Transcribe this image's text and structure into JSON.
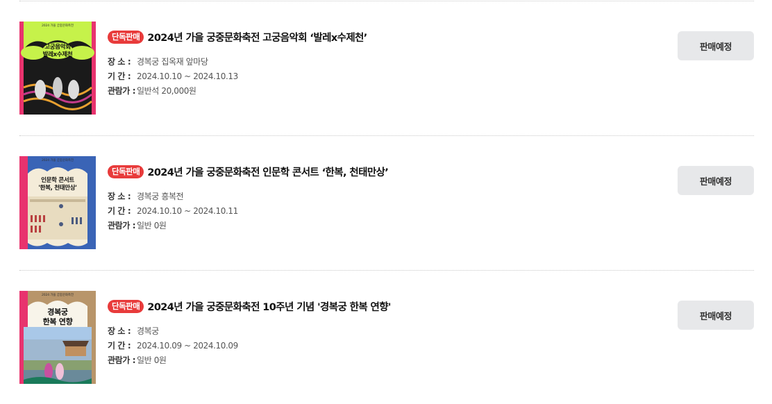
{
  "list": {
    "items": [
      {
        "badge": "단독판매",
        "title": "2024년 가을 궁중문화축전 고궁음악회 ‘발레x수제천’",
        "venue_label": "장  소 :",
        "venue": "경복궁 집옥재 앞마당",
        "period_label": "기  간 :",
        "period": "2024.10.10 ~ 2024.10.13",
        "price_label": "관람가 :",
        "price": "일반석 20,000원",
        "button": "판매예정",
        "poster": {
          "header": "2024 가을 궁중문화축전",
          "title_line1": "고궁음악회",
          "title_line2": "발레x수제천",
          "bg_color": "#c6f24a",
          "accent_color": "#e8336e"
        }
      },
      {
        "badge": "단독판매",
        "title": "2024년 가을 궁중문화축전 인문학 콘서트 ‘한복, 천태만상’",
        "venue_label": "장  소 :",
        "venue": "경복궁 흥복전",
        "period_label": "기  간 :",
        "period": "2024.10.10 ~ 2024.10.11",
        "price_label": "관람가 :",
        "price": "일반 0원",
        "button": "판매예정",
        "poster": {
          "header": "2024 가을 궁중문화축전",
          "title_line1": "인문학 콘서트",
          "title_line2": "'한복, 천태만상'",
          "bg_color": "#3a64b6",
          "accent_color": "#e8336e"
        }
      },
      {
        "badge": "단독판매",
        "title": "2024년 가을 궁중문화축전 10주년 기념 '경복궁 한복 연향'",
        "venue_label": "장  소 :",
        "venue": "경복궁",
        "period_label": "기  간 :",
        "period": "2024.10.09 ~ 2024.10.09",
        "price_label": "관람가 :",
        "price": "일반 0원",
        "button": "판매예정",
        "poster": {
          "header": "2024 가을 궁중문화축전",
          "title_line1": "경복궁",
          "title_line2": "한복 연향",
          "bg_color": "#b8956a",
          "accent_color": "#e8336e"
        }
      }
    ]
  }
}
